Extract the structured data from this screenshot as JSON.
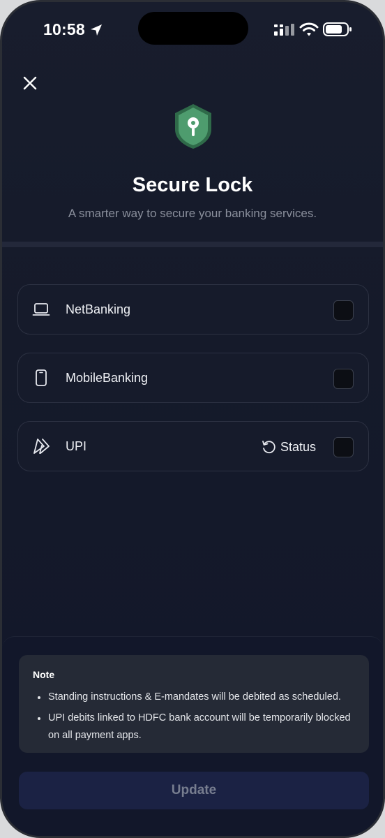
{
  "status_bar": {
    "time": "10:58",
    "icons": [
      "location-arrow-icon",
      "signal-icon",
      "wifi-icon",
      "battery-icon"
    ]
  },
  "header": {
    "close_icon": "close-icon",
    "logo_icon": "shield-key-icon",
    "title": "Secure Lock",
    "subtitle": "A smarter way to secure your banking services."
  },
  "options": [
    {
      "label": "NetBanking",
      "icon": "laptop-icon",
      "checked": false
    },
    {
      "label": "MobileBanking",
      "icon": "phone-icon",
      "checked": false
    },
    {
      "label": "UPI",
      "icon": "upi-icon",
      "checked": false,
      "status_label": "Status",
      "status_icon": "refresh-icon"
    }
  ],
  "note": {
    "title": "Note",
    "items": [
      "Standing instructions & E-mandates will be debited as scheduled.",
      "UPI debits linked to HDFC bank account will be temporarily blocked on all payment apps."
    ]
  },
  "footer": {
    "update_label": "Update"
  },
  "colors": {
    "background": "#151a2a",
    "shield": "#4e9c6e",
    "button_bg": "#1b2244",
    "button_text": "#777d8f"
  }
}
